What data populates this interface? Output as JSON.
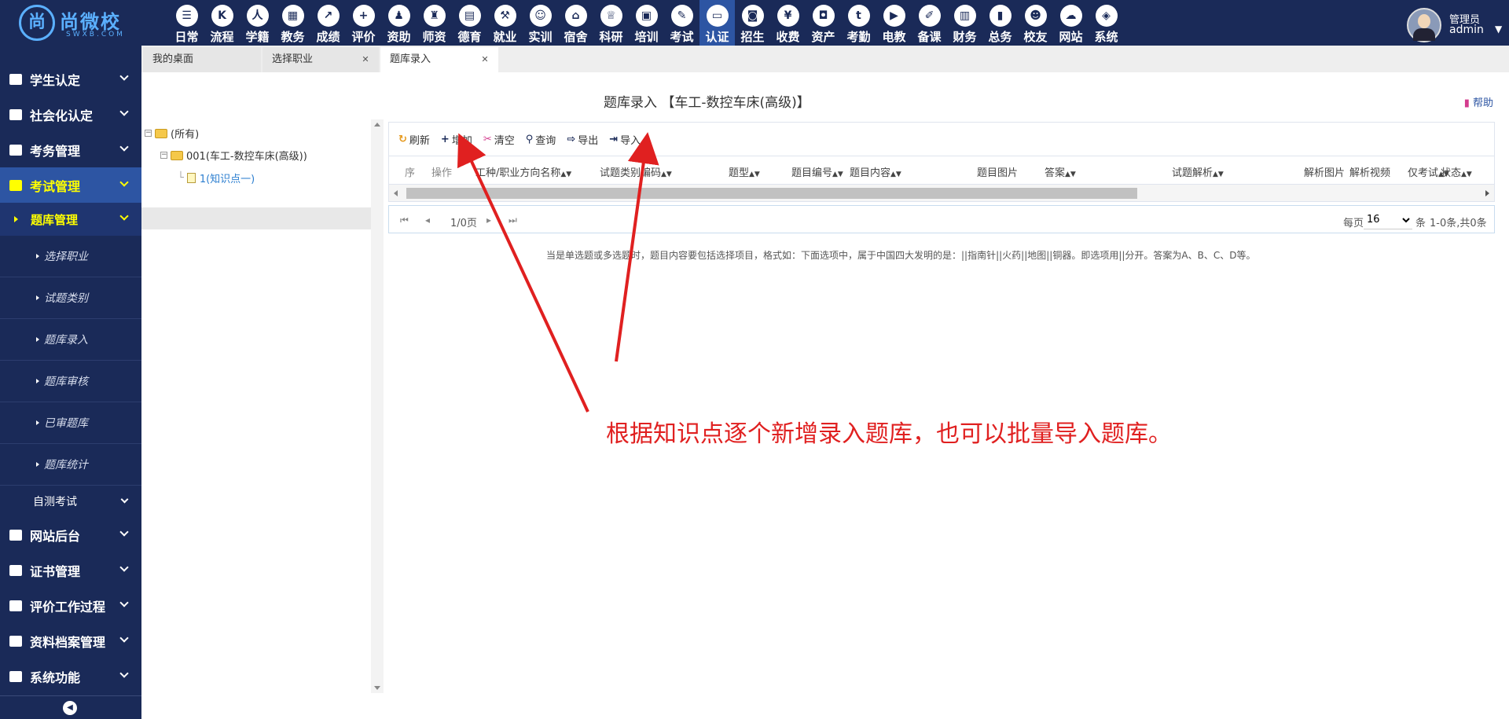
{
  "logo": {
    "main": "尚微校",
    "sub": "SWXB.COM",
    "mark": "尚"
  },
  "topnav": [
    {
      "label": "日常",
      "icon": "calendar-icon",
      "glyph": "☰"
    },
    {
      "label": "流程",
      "icon": "flow-icon",
      "glyph": "K"
    },
    {
      "label": "学籍",
      "icon": "student-icon",
      "glyph": "人"
    },
    {
      "label": "教务",
      "icon": "schedule-icon",
      "glyph": "▦"
    },
    {
      "label": "成绩",
      "icon": "chart-icon",
      "glyph": "↗"
    },
    {
      "label": "评价",
      "icon": "evaluate-icon",
      "glyph": "+"
    },
    {
      "label": "资助",
      "icon": "aid-icon",
      "glyph": "♟"
    },
    {
      "label": "师资",
      "icon": "teacher-icon",
      "glyph": "♜"
    },
    {
      "label": "德育",
      "icon": "book-icon",
      "glyph": "▤"
    },
    {
      "label": "就业",
      "icon": "hammer-icon",
      "glyph": "⚒"
    },
    {
      "label": "实训",
      "icon": "robot-icon",
      "glyph": "☺"
    },
    {
      "label": "宿舍",
      "icon": "home-icon",
      "glyph": "⌂"
    },
    {
      "label": "科研",
      "icon": "graduation-icon",
      "glyph": "♕"
    },
    {
      "label": "培训",
      "icon": "image-icon",
      "glyph": "▣"
    },
    {
      "label": "考试",
      "icon": "wrench-icon",
      "glyph": "✎"
    },
    {
      "label": "认证",
      "icon": "monitor-icon",
      "glyph": "▭",
      "active": true
    },
    {
      "label": "招生",
      "icon": "bus-icon",
      "glyph": "◙"
    },
    {
      "label": "收费",
      "icon": "yen-icon",
      "glyph": "¥"
    },
    {
      "label": "资产",
      "icon": "train-icon",
      "glyph": "◘"
    },
    {
      "label": "考勤",
      "icon": "tumblr-icon",
      "glyph": "t"
    },
    {
      "label": "电教",
      "icon": "media-icon",
      "glyph": "▶"
    },
    {
      "label": "备课",
      "icon": "edit-icon",
      "glyph": "✐"
    },
    {
      "label": "财务",
      "icon": "newspaper-icon",
      "glyph": "▥"
    },
    {
      "label": "总务",
      "icon": "bar-chart-icon",
      "glyph": "▮"
    },
    {
      "label": "校友",
      "icon": "users-icon",
      "glyph": "☻"
    },
    {
      "label": "网站",
      "icon": "cloud-icon",
      "glyph": "☁"
    },
    {
      "label": "系统",
      "icon": "cube-icon",
      "glyph": "◈"
    }
  ],
  "user": {
    "role": "管理员",
    "name": "admin"
  },
  "sidebar": {
    "sections_top": [
      {
        "label": "学生认定",
        "name": "sidebar-item-student-cert"
      },
      {
        "label": "社会化认定",
        "name": "sidebar-item-social-cert"
      },
      {
        "label": "考务管理",
        "name": "sidebar-item-exam-affairs"
      }
    ],
    "active_section": "考试管理",
    "active_sub": "题库管理",
    "leaves": [
      "选择职业",
      "试题类别",
      "题库录入",
      "题库审核",
      "已审题库",
      "题库统计"
    ],
    "plain": "自测考试",
    "sections_bottom": [
      {
        "label": "网站后台",
        "name": "sidebar-item-website"
      },
      {
        "label": "证书管理",
        "name": "sidebar-item-certificates"
      },
      {
        "label": "评价工作过程",
        "name": "sidebar-item-evaluation"
      },
      {
        "label": "资料档案管理",
        "name": "sidebar-item-archives"
      },
      {
        "label": "系统功能",
        "name": "sidebar-item-system"
      }
    ]
  },
  "tabs": [
    {
      "label": "我的桌面",
      "closable": false,
      "width": 150
    },
    {
      "label": "选择职业",
      "closable": true,
      "width": 148
    },
    {
      "label": "题库录入",
      "closable": true,
      "width": 150,
      "active": true
    }
  ],
  "page": {
    "title": "题库录入 【车工-数控车床(高级)】",
    "help": "帮助"
  },
  "tree": {
    "root": "(所有)",
    "child": "001(车工-数控车床(高级))",
    "leaf": "1(知识点一)"
  },
  "toolbar": [
    {
      "label": "刷新",
      "icon": "refresh-icon",
      "glyph": "↻",
      "color": "#e69a1e"
    },
    {
      "label": "增加",
      "icon": "plus-icon",
      "glyph": "+",
      "color": "#1a2a58"
    },
    {
      "label": "清空",
      "icon": "scissors-icon",
      "glyph": "✂",
      "color": "#d43c8e"
    },
    {
      "label": "查询",
      "icon": "search-icon",
      "glyph": "⚲",
      "color": "#1a2a58"
    },
    {
      "label": "导出",
      "icon": "export-icon",
      "glyph": "⇨",
      "color": "#1a2a58"
    },
    {
      "label": "导入",
      "icon": "import-icon",
      "glyph": "⇥",
      "color": "#1a2a58"
    }
  ],
  "columns": [
    "序",
    "操作",
    "工种/职业方向名称",
    "试题类别编码",
    "题型",
    "题目编号",
    "题目内容",
    "题目图片",
    "答案",
    "试题解析",
    "解析图片",
    "解析视频",
    "仅考试",
    "状态"
  ],
  "pager": {
    "page_info": "1/0页",
    "per_page_label": "每页",
    "per_page": "16",
    "unit": "条",
    "summary": "1-0条,共0条"
  },
  "hint": "当是单选题或多选题时，题目内容要包括选择项目，格式如：下面选项中，属于中国四大发明的是：||指南针||火药||地图||铜器。即选项用||分开。答案为A、B、C、D等。",
  "annotation": "根据知识点逐个新增录入题库，也可以批量导入题库。",
  "colors": {
    "nav_bg": "#1a2a58",
    "nav_active": "#2d55a3",
    "highlight": "#ffff00",
    "annotation": "#e02020"
  }
}
